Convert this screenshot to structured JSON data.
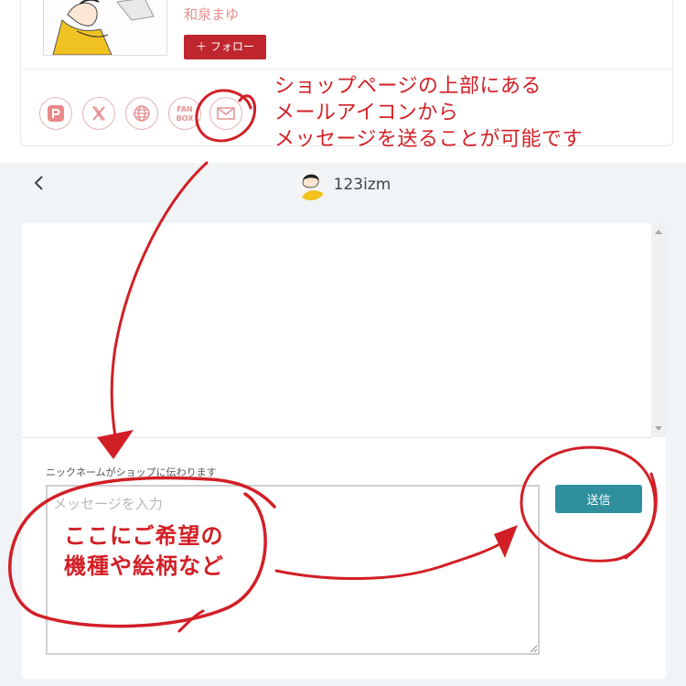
{
  "shop": {
    "name": "和泉まゆ",
    "follow_label": "＋ フォロー"
  },
  "social": [
    {
      "icon": "pixiv-icon"
    },
    {
      "icon": "x-icon"
    },
    {
      "icon": "globe-icon"
    },
    {
      "icon": "fanbox-icon",
      "text_top": "FAN",
      "text_bottom": "BOX"
    },
    {
      "icon": "mail-icon"
    }
  ],
  "chat": {
    "shop_handle": "123izm",
    "notice": "ニックネームがショップに伝わります",
    "input_placeholder": "メッセージを入力",
    "send_label": "送信"
  },
  "annotations": {
    "top_note": [
      "ショップページの上部にある",
      "メールアイコンから",
      "メッセージを送ることが可能です"
    ],
    "input_note": [
      "ここにご希望の",
      "機種や絵柄など"
    ]
  },
  "colors": {
    "annotation_red": "#d21f26",
    "follow_button": "#c0262e",
    "send_button": "#2f8f9d",
    "social_border": "#e2b4b4"
  }
}
